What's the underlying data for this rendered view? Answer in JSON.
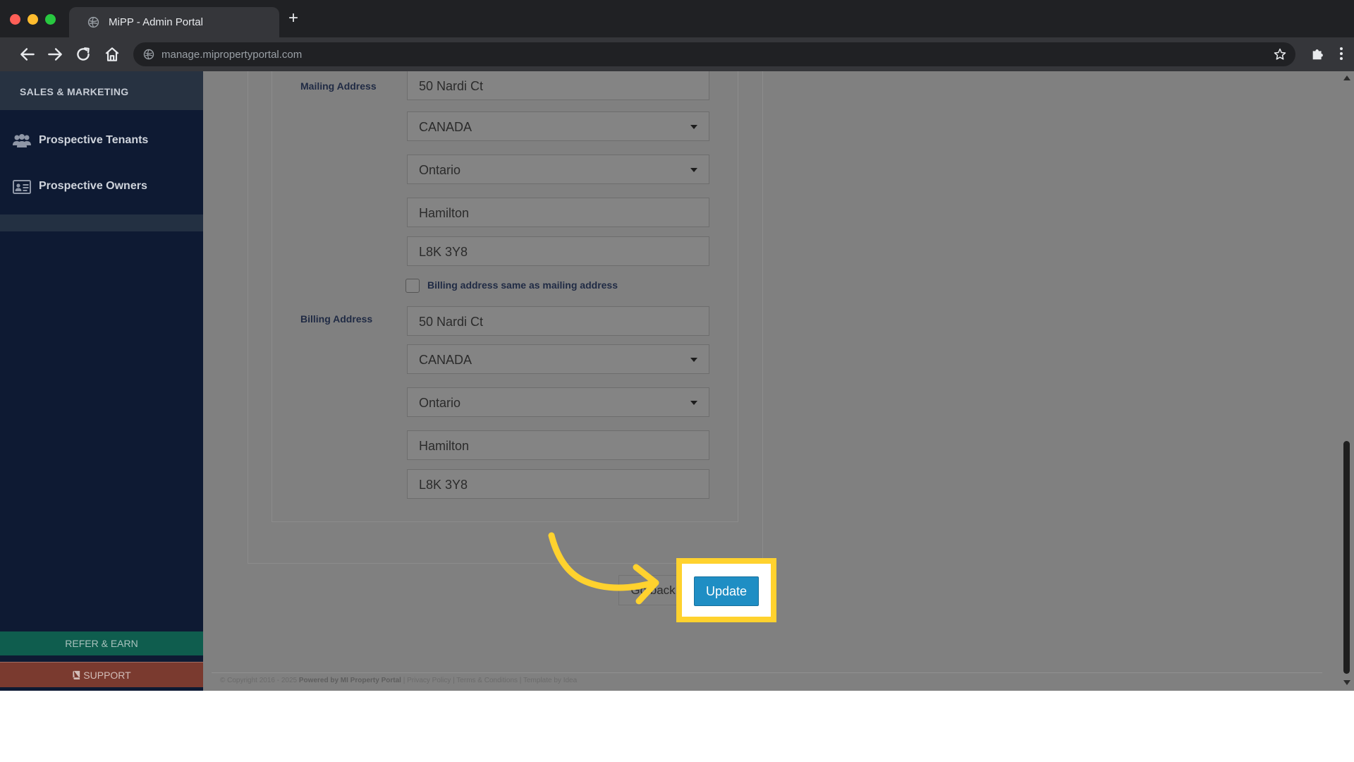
{
  "browser": {
    "tab_title": "MiPP - Admin Portal",
    "new_tab": "+",
    "url": "manage.mipropertyportal.com"
  },
  "sidebar": {
    "section_title": "SALES & MARKETING",
    "items": [
      {
        "label": "Prospective Tenants",
        "icon": "users-icon"
      },
      {
        "label": "Prospective Owners",
        "icon": "id-card-icon"
      }
    ],
    "refer_label": "REFER & EARN",
    "support_label": "SUPPORT"
  },
  "form": {
    "mailing_label": "Mailing Address",
    "mailing": {
      "street": "50 Nardi Ct",
      "country": "CANADA",
      "province": "Ontario",
      "city": "Hamilton",
      "postal": "L8K 3Y8"
    },
    "same_as_mailing_label": "Billing address same as mailing address",
    "same_as_mailing_checked": false,
    "billing_label": "Billing Address",
    "billing": {
      "street": "50 Nardi Ct",
      "country": "CANADA",
      "province": "Ontario",
      "city": "Hamilton",
      "postal": "L8K 3Y8"
    },
    "cancel_label": "Go back",
    "update_label": "Update"
  },
  "footer": {
    "copyright": "© Copyright 2016 - 2025",
    "powered": "Powered by MI Property Portal",
    "links": "| Privacy Policy | Terms & Conditions |",
    "template": "Template by Idea"
  },
  "colors": {
    "highlight": "#ffd22e",
    "update_button": "#1f8ec4",
    "sidebar_bg": "#0e1a33"
  }
}
